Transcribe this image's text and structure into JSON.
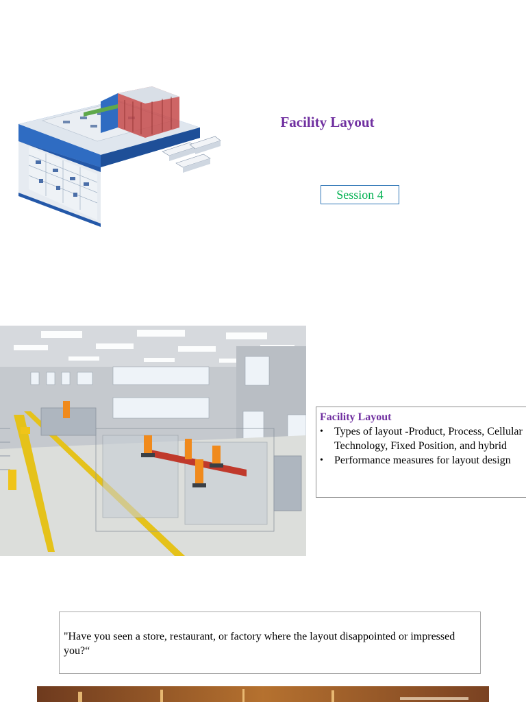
{
  "slide1": {
    "title": "Facility Layout",
    "session": "Session 4",
    "image": "isometric-facility-layout-render"
  },
  "slide2": {
    "image": "factory-floor-robotic-cells-photo",
    "heading": "Facility Layout",
    "bullets": [
      "Types of layout -Product, Process, Cellular Technology, Fixed Position, and hybrid",
      "Performance measures for layout design"
    ]
  },
  "slide3": {
    "question": "\"Have you seen a store, restaurant, or factory where the layout disappointed or impressed you?“",
    "image": "restaurant-interior-photo"
  },
  "colors": {
    "title": "#7030a0",
    "session_text": "#00b050",
    "session_border": "#2e75b6"
  }
}
